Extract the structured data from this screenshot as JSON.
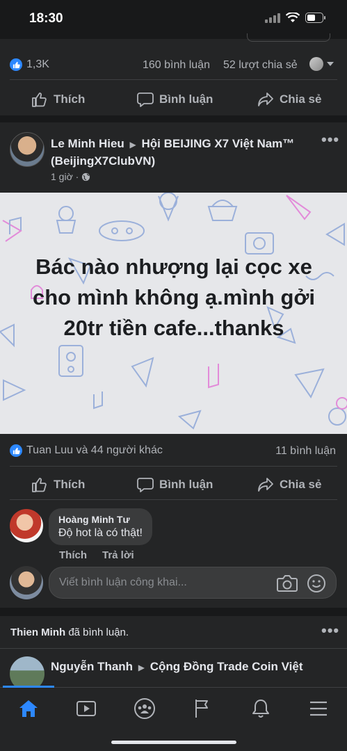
{
  "status": {
    "time": "18:30"
  },
  "prev_post": {
    "reactions": "1,3K",
    "comments": "160 bình luận",
    "shares": "52 lượt chia sẻ"
  },
  "actions": {
    "like": "Thích",
    "comment": "Bình luận",
    "share": "Chia sẻ"
  },
  "post": {
    "author": "Le Minh Hieu",
    "group": "Hội BEIJING X7 Việt Nam™ (BeijingX7ClubVN)",
    "time": "1 giờ ·",
    "body": "Bác nào nhượng lại cọc xe cho mình không ạ.mình gởi 20tr tiền cafe...thanks",
    "reactions": "Tuan Luu và 44 người khác",
    "comments": "11 bình luận"
  },
  "comment": {
    "author": "Hoàng Minh Tư",
    "text": "Độ hot là có thật!",
    "like": "Thích",
    "reply": "Trả lời"
  },
  "composer": {
    "placeholder": "Viết bình luận công khai..."
  },
  "next_post": {
    "activity_name": "Thien Minh",
    "activity_suffix": " đã bình luận.",
    "author": "Nguyễn Thanh",
    "group": "Cộng Đồng Trade Coin Việt"
  },
  "colors": {
    "accent": "#2d88ff",
    "background": "#18191a",
    "card": "#242526"
  }
}
